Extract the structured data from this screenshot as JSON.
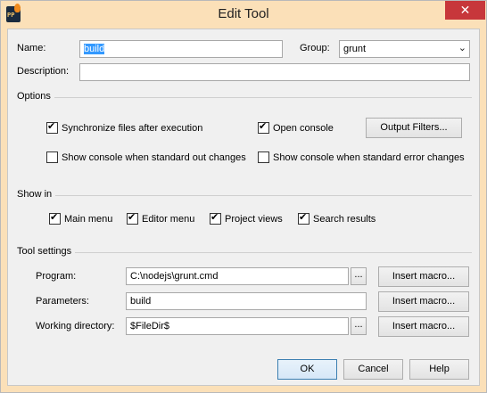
{
  "window": {
    "title": "Edit Tool",
    "close_glyph": "✕",
    "icon_text": "PP"
  },
  "form": {
    "name_label": "Name:",
    "name_value": "build",
    "group_label": "Group:",
    "group_value": "grunt",
    "description_label": "Description:",
    "description_value": ""
  },
  "options": {
    "header": "Options",
    "sync_files": {
      "label": "Synchronize files after execution",
      "checked": true
    },
    "open_console": {
      "label": "Open console",
      "checked": true
    },
    "output_filters_button": "Output Filters...",
    "show_console_stdout": {
      "label": "Show console when standard out changes",
      "checked": false
    },
    "show_console_stderr": {
      "label": "Show console when standard error changes",
      "checked": false
    }
  },
  "show_in": {
    "header": "Show in",
    "main_menu": {
      "label": "Main menu",
      "checked": true
    },
    "editor_menu": {
      "label": "Editor menu",
      "checked": true
    },
    "project_views": {
      "label": "Project views",
      "checked": true
    },
    "search_results": {
      "label": "Search results",
      "checked": true
    }
  },
  "tool_settings": {
    "header": "Tool settings",
    "program_label": "Program:",
    "program_value": "C:\\nodejs\\grunt.cmd",
    "parameters_label": "Parameters:",
    "parameters_value": "build",
    "working_dir_label": "Working directory:",
    "working_dir_value": "$FileDir$",
    "browse_label": "...",
    "insert_macro_label": "Insert macro..."
  },
  "buttons": {
    "ok": "OK",
    "cancel": "Cancel",
    "help": "Help"
  }
}
